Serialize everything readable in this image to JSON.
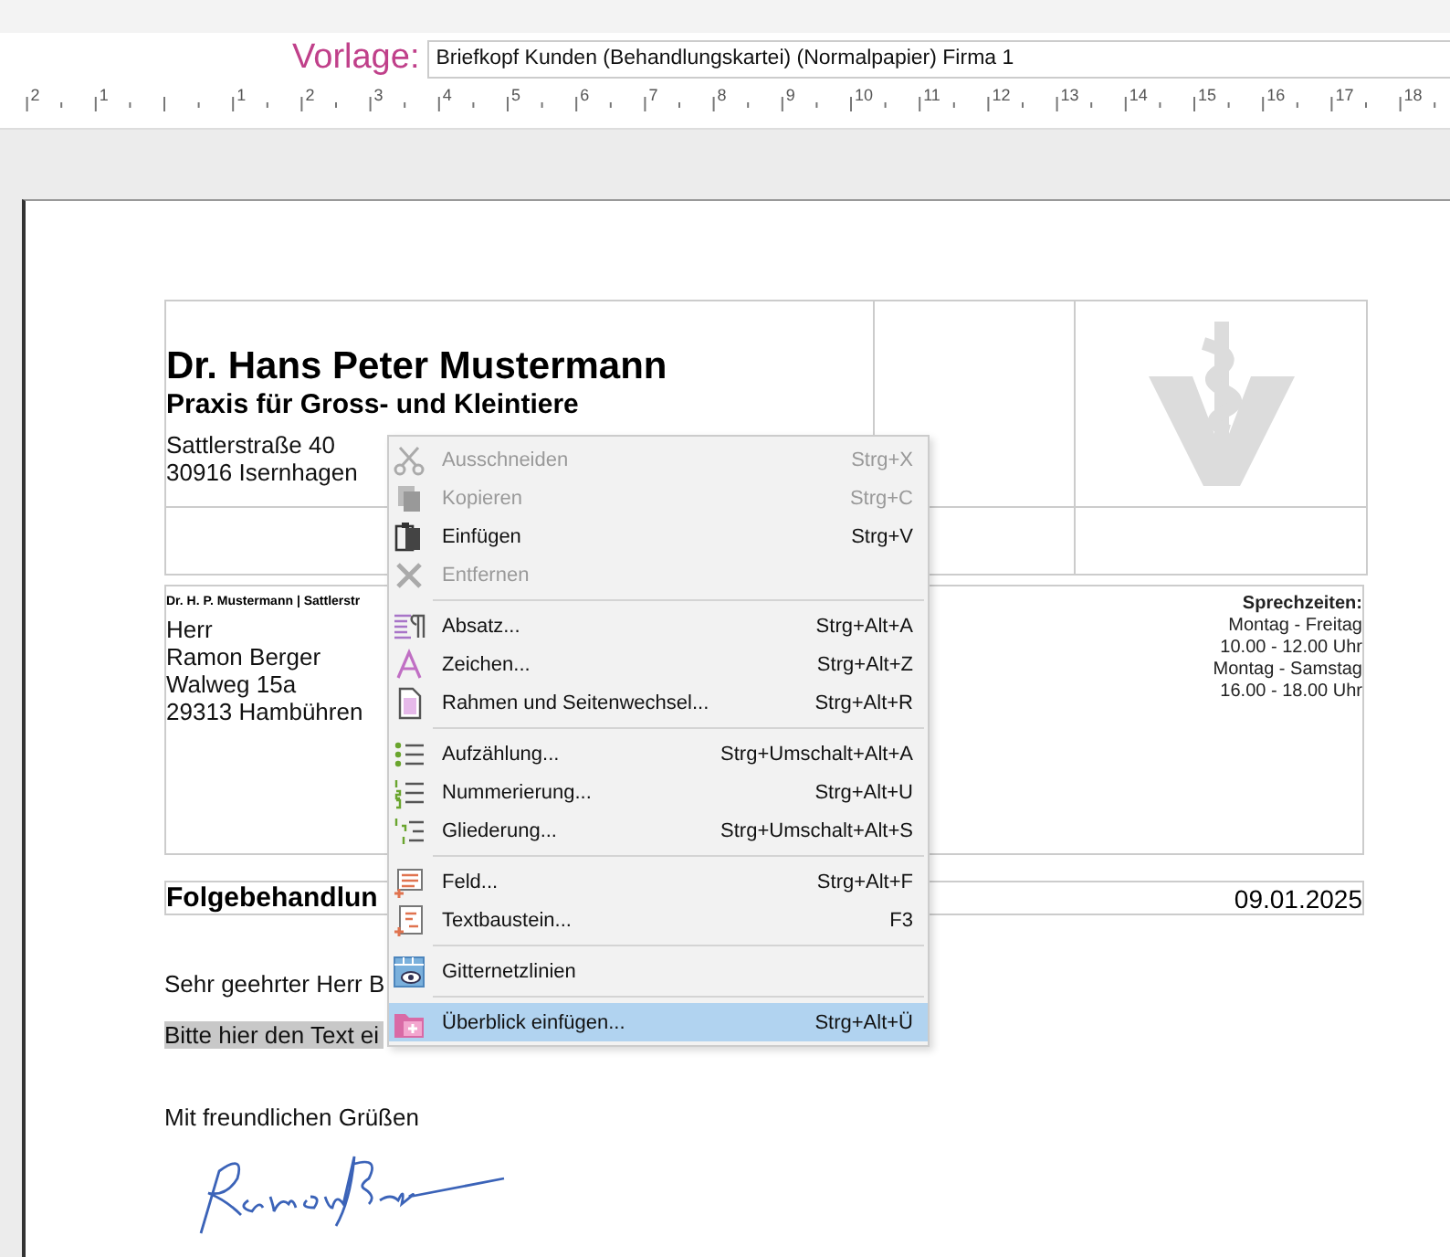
{
  "template_bar": {
    "label": "Vorlage:",
    "value": "Briefkopf Kunden (Behandlungskartei) (Normalpapier) Firma 1"
  },
  "ruler": {
    "labels": [
      "2",
      "1",
      "1",
      "2",
      "3",
      "4",
      "5",
      "6",
      "7",
      "8",
      "9",
      "10",
      "11",
      "12",
      "13",
      "14",
      "15",
      "16",
      "17",
      "18"
    ]
  },
  "letterhead": {
    "name": "Dr. Hans Peter Mustermann",
    "practice": "Praxis für Gross- und Kleintiere",
    "street": "Sattlerstraße 40",
    "city": "30916 Isernhagen"
  },
  "address": {
    "sender_line": "Dr. H. P. Mustermann | Sattlerstr",
    "lines": [
      "Herr",
      "Ramon Berger",
      "Walweg 15a",
      "29313 Hambühren"
    ]
  },
  "office_hours": {
    "title": "Sprechzeiten:",
    "lines": [
      "Montag - Freitag",
      "10.00 - 12.00 Uhr",
      "Montag - Samstag",
      "16.00 - 18.00 Uhr"
    ]
  },
  "subject": {
    "text": "Folgebehandlun",
    "date": "09.01.2025"
  },
  "body": {
    "salutation": "Sehr geehrter Herr B",
    "placeholder_text": "Bitte hier den Text ei",
    "closing": "Mit freundlichen Grüßen"
  },
  "context_menu": [
    {
      "kind": "item",
      "label": "Ausschneiden",
      "shortcut": "Strg+X",
      "disabled": true,
      "selected": false
    },
    {
      "kind": "item",
      "label": "Kopieren",
      "shortcut": "Strg+C",
      "disabled": true,
      "selected": false
    },
    {
      "kind": "item",
      "label": "Einfügen",
      "shortcut": "Strg+V",
      "disabled": false,
      "selected": false
    },
    {
      "kind": "item",
      "label": "Entfernen",
      "disabled": true,
      "selected": false
    },
    {
      "kind": "separator"
    },
    {
      "kind": "item",
      "label": "Absatz...",
      "shortcut": "Strg+Alt+A",
      "disabled": false,
      "selected": false
    },
    {
      "kind": "item",
      "label": "Zeichen...",
      "shortcut": "Strg+Alt+Z",
      "disabled": false,
      "selected": false
    },
    {
      "kind": "item",
      "label": "Rahmen und Seitenwechsel...",
      "shortcut": "Strg+Alt+R",
      "disabled": false,
      "selected": false
    },
    {
      "kind": "separator"
    },
    {
      "kind": "item",
      "label": "Aufzählung...",
      "shortcut": "Strg+Umschalt+Alt+A",
      "disabled": false,
      "selected": false
    },
    {
      "kind": "item",
      "label": "Nummerierung...",
      "shortcut": "Strg+Alt+U",
      "disabled": false,
      "selected": false
    },
    {
      "kind": "item",
      "label": "Gliederung...",
      "shortcut": "Strg+Umschalt+Alt+S",
      "disabled": false,
      "selected": false
    },
    {
      "kind": "separator"
    },
    {
      "kind": "item",
      "label": "Feld...",
      "shortcut": "Strg+Alt+F",
      "disabled": false,
      "selected": false
    },
    {
      "kind": "item",
      "label": "Textbaustein...",
      "shortcut": "F3",
      "disabled": false,
      "selected": false
    },
    {
      "kind": "separator"
    },
    {
      "kind": "item",
      "label": "Gitternetzlinien",
      "disabled": false,
      "selected": false
    },
    {
      "kind": "separator"
    },
    {
      "kind": "item",
      "label": "Überblick einfügen...",
      "shortcut": "Strg+Alt+Ü",
      "disabled": false,
      "selected": true
    }
  ]
}
